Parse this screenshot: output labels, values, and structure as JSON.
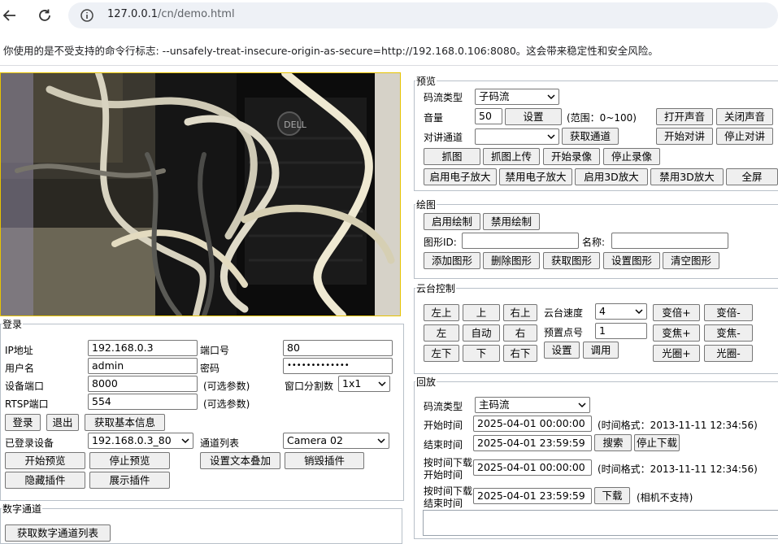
{
  "browser": {
    "url_host": "127.0.0.1",
    "url_path": "/cn/demo.html",
    "warning": "你使用的是不受支持的命令行标志: --unsafely-treat-insecure-origin-as-secure=http://192.168.0.106:8080。这会带来稳定性和安全风险。"
  },
  "preview": {
    "legend": "预览",
    "stream_type_label": "码流类型",
    "stream_type_value": "子码流",
    "volume_label": "音量",
    "volume_value": "50",
    "set_button": "设置",
    "range_hint": "(范围：0~100)",
    "open_sound": "打开声音",
    "close_sound": "关闭声音",
    "talk_channel_label": "对讲通道",
    "talk_channel_value": "",
    "get_channel": "获取通道",
    "start_talk": "开始对讲",
    "stop_talk": "停止对讲",
    "capture": "抓图",
    "capture_upload": "抓图上传",
    "start_record": "开始录像",
    "stop_record": "停止录像",
    "enable_ezoom": "启用电子放大",
    "disable_ezoom": "禁用电子放大",
    "enable_3dzoom": "启用3D放大",
    "disable_3dzoom": "禁用3D放大",
    "fullscreen": "全屏"
  },
  "draw": {
    "legend": "绘图",
    "enable_draw": "启用绘制",
    "disable_draw": "禁用绘制",
    "shape_id_label": "图形ID:",
    "shape_id_value": "",
    "name_label": "名称:",
    "name_value": "",
    "add_shape": "添加图形",
    "delete_shape": "删除图形",
    "get_shape": "获取图形",
    "set_shape": "设置图形",
    "clear_shape": "清空图形"
  },
  "ptz": {
    "legend": "云台控制",
    "up_left": "左上",
    "up": "上",
    "up_right": "右上",
    "left": "左",
    "auto": "自动",
    "right": "右",
    "down_left": "左下",
    "down": "下",
    "down_right": "右下",
    "speed_label": "云台速度",
    "speed_value": "4",
    "preset_label": "预置点号",
    "preset_value": "1",
    "set": "设置",
    "call": "调用",
    "zoom_in": "变倍+",
    "zoom_out": "变倍-",
    "focus_in": "变焦+",
    "focus_out": "变焦-",
    "iris_in": "光圈+",
    "iris_out": "光圈-"
  },
  "playback": {
    "legend": "回放",
    "stream_type_label": "码流类型",
    "stream_type_value": "主码流",
    "start_time_label": "开始时间",
    "start_time_value": "2025-04-01 00:00:00",
    "time_format_hint": "(时间格式：2013-11-11 12:34:56)",
    "end_time_label": "结束时间",
    "end_time_value": "2025-04-01 23:59:59",
    "search": "搜索",
    "stop_download": "停止下载",
    "dl_start_label_1": "按时间下载",
    "dl_start_label_2": "开始时间",
    "dl_start_value": "2025-04-01 00:00:00",
    "dl_time_format_hint": "(时间格式：2013-11-11 12:34:56)",
    "dl_end_label_1": "按时间下载",
    "dl_end_label_2": "结束时间",
    "dl_end_value": "2025-04-01 23:59:59",
    "download": "下载",
    "camera_not_supported": "(相机不支持)"
  },
  "login": {
    "legend": "登录",
    "ip_label": "IP地址",
    "ip_value": "192.168.0.3",
    "port_label": "端口号",
    "port_value": "80",
    "user_label": "用户名",
    "user_value": "admin",
    "password_label": "密码",
    "password_value": "•••••••••••••",
    "device_port_label": "设备端口",
    "device_port_value": "8000",
    "optional_1": "(可选参数)",
    "window_split_label": "窗口分割数",
    "window_split_value": "1x1",
    "rtsp_label": "RTSP端口",
    "rtsp_value": "554",
    "optional_2": "(可选参数)",
    "login_btn": "登录",
    "logout_btn": "退出",
    "get_basic_info": "获取基本信息",
    "logged_devices_label": "已登录设备",
    "logged_devices_value": "192.168.0.3_80",
    "channel_list_label": "通道列表",
    "channel_list_value": "Camera 02",
    "start_preview": "开始预览",
    "stop_preview": "停止预览",
    "set_text_overlay": "设置文本叠加",
    "destroy_plugin": "销毁插件",
    "hide_plugin": "隐藏插件",
    "show_plugin": "展示插件"
  },
  "digital": {
    "legend": "数字通道",
    "get_list_button": "获取数字通道列表"
  }
}
